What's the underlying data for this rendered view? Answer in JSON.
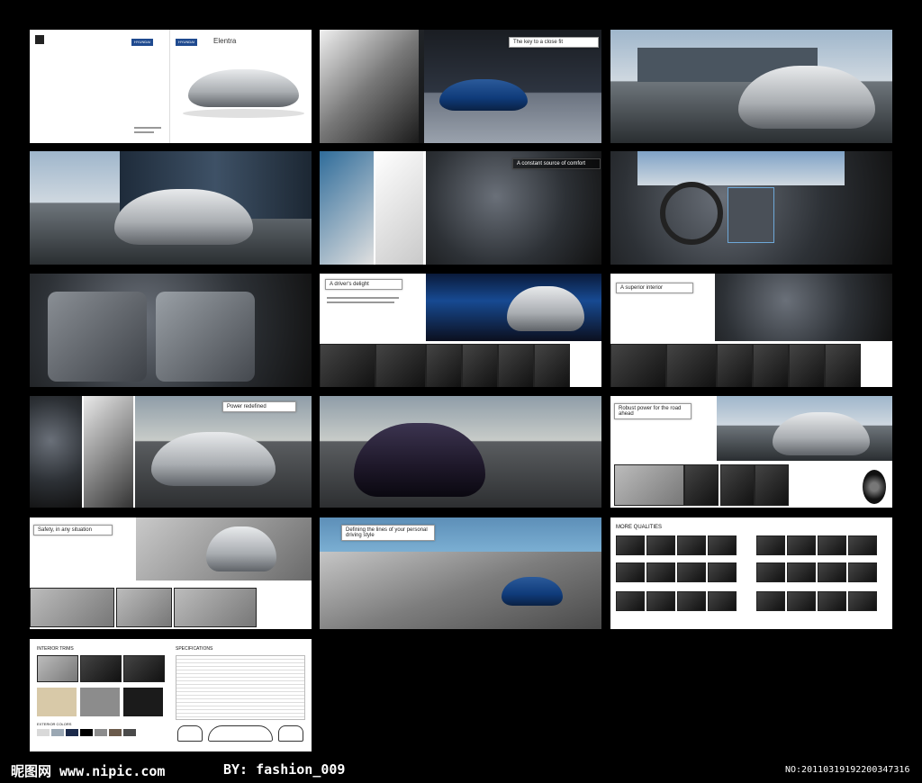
{
  "cover": {
    "brand": "HYUNDAI",
    "model": "Elentra"
  },
  "spreads": {
    "s02_title": "The key to a close fit",
    "s05_title": "A constant source of comfort",
    "s08_title": "A driver's delight",
    "s09_title": "A superior interior",
    "s10_title": "Power redefined",
    "s12_title": "Robust power for the road ahead",
    "s13_title": "Safety, in any situation",
    "s14_title": "Defining the lines of your personal driving style",
    "s15_title": "MORE QUALITIES",
    "s16_title_left": "INTERIOR TRIMS",
    "s16_title_right": "SPECIFICATIONS",
    "s16_subtitle": "EXTERIOR COLORS"
  },
  "footer": {
    "site": "昵图网 www.nipic.com",
    "author": "BY: fashion_009",
    "id": "NO:20110319192200347316"
  },
  "colors": {
    "background": "#000000",
    "brand_blue": "#1f4a8f"
  }
}
